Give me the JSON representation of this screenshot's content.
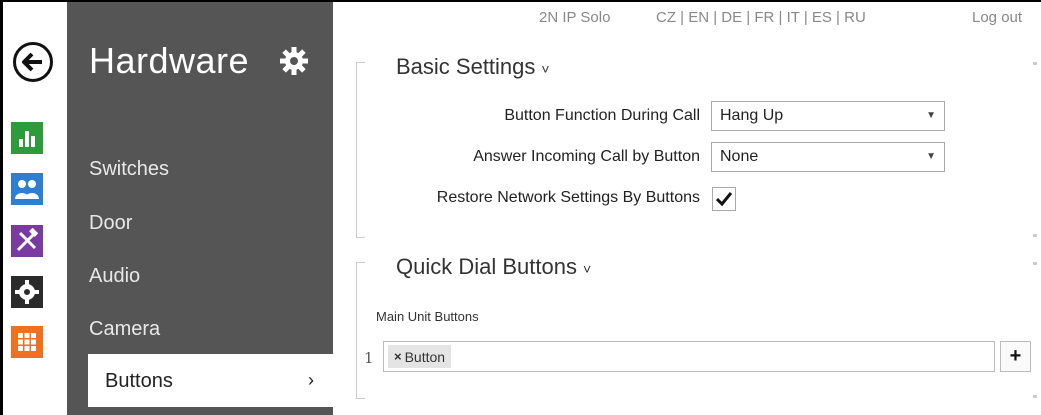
{
  "header": {
    "device": "2N IP Solo",
    "languages": "CZ | EN | DE | FR | IT | ES | RU",
    "logout": "Log out"
  },
  "rail": {
    "icons": [
      "back-icon",
      "status-icon",
      "directory-icon",
      "services-icon",
      "hardware-icon",
      "system-icon"
    ],
    "colors": {
      "status": "#2e9b3a",
      "directory": "#2e7fd1",
      "services": "#7a3aa0",
      "hardware": "#2b2b2b",
      "system": "#f07020"
    }
  },
  "sidebar": {
    "title": "Hardware",
    "items": [
      {
        "label": "Switches"
      },
      {
        "label": "Door"
      },
      {
        "label": "Audio"
      },
      {
        "label": "Camera"
      },
      {
        "label": "Buttons",
        "active": true
      }
    ],
    "active_chevron": "›"
  },
  "basic_settings": {
    "title": "Basic Settings",
    "chevron": "˅",
    "button_function": {
      "label": "Button Function During Call",
      "value": "Hang Up"
    },
    "answer_incoming": {
      "label": "Answer Incoming Call by Button",
      "value": "None"
    },
    "restore_network": {
      "label": "Restore Network Settings By Buttons",
      "checked": true
    }
  },
  "quick_dial": {
    "title": "Quick Dial Buttons",
    "chevron": "˅",
    "main_unit_label": "Main Unit Buttons",
    "rows": [
      {
        "index": "1",
        "tag": "Button",
        "remove": "×"
      }
    ],
    "add_label": "+"
  }
}
